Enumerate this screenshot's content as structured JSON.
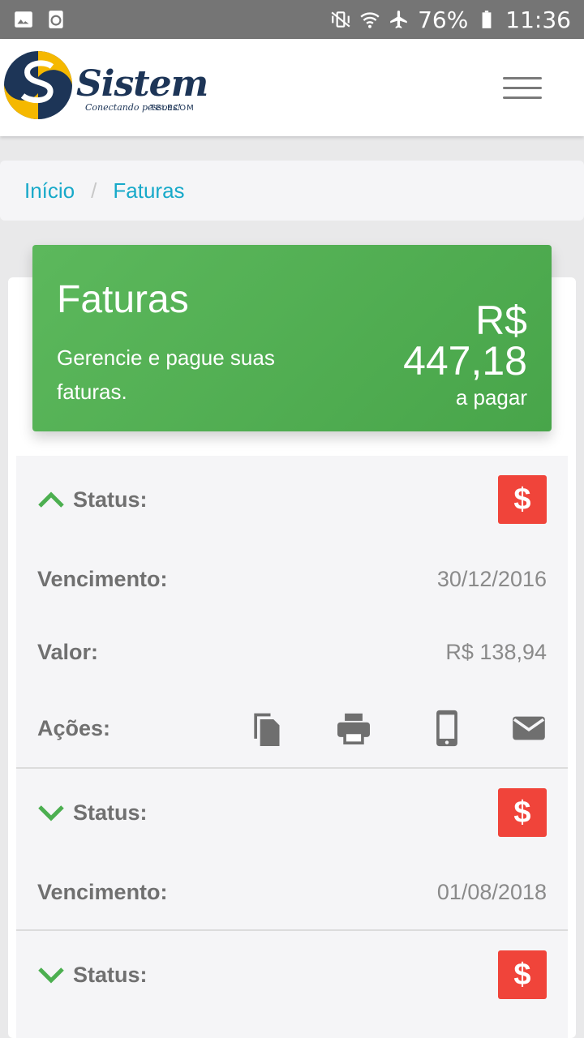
{
  "status_bar": {
    "battery": "76%",
    "time": "11:36"
  },
  "header": {
    "logo_name": "Sistem",
    "logo_sub": "TELECOM",
    "logo_tagline": "Conectando pessoas!"
  },
  "breadcrumb": {
    "home": "Início",
    "separator": "/",
    "current": "Faturas"
  },
  "hero": {
    "title": "Faturas",
    "description": "Gerencie e pague suas faturas.",
    "currency": "R$",
    "amount": "447,18",
    "amount_label": "a pagar",
    "color": "#4caf50"
  },
  "invoices": [
    {
      "expanded": true,
      "status_label": "Status:",
      "due_label": "Vencimento:",
      "due_date": "30/12/2016",
      "value_label": "Valor:",
      "value": "R$ 138,94",
      "actions_label": "Ações:",
      "actions": [
        "copy-icon",
        "print-icon",
        "phone-icon",
        "mail-icon"
      ],
      "pay_icon": "$"
    },
    {
      "expanded": false,
      "status_label": "Status:",
      "due_label": "Vencimento:",
      "due_date": "01/08/2018",
      "pay_icon": "$"
    },
    {
      "expanded": false,
      "status_label": "Status:",
      "pay_icon": "$"
    }
  ],
  "colors": {
    "accent_link": "#17a9c9",
    "pay_button": "#f0443a",
    "chevron": "#4caf50"
  }
}
